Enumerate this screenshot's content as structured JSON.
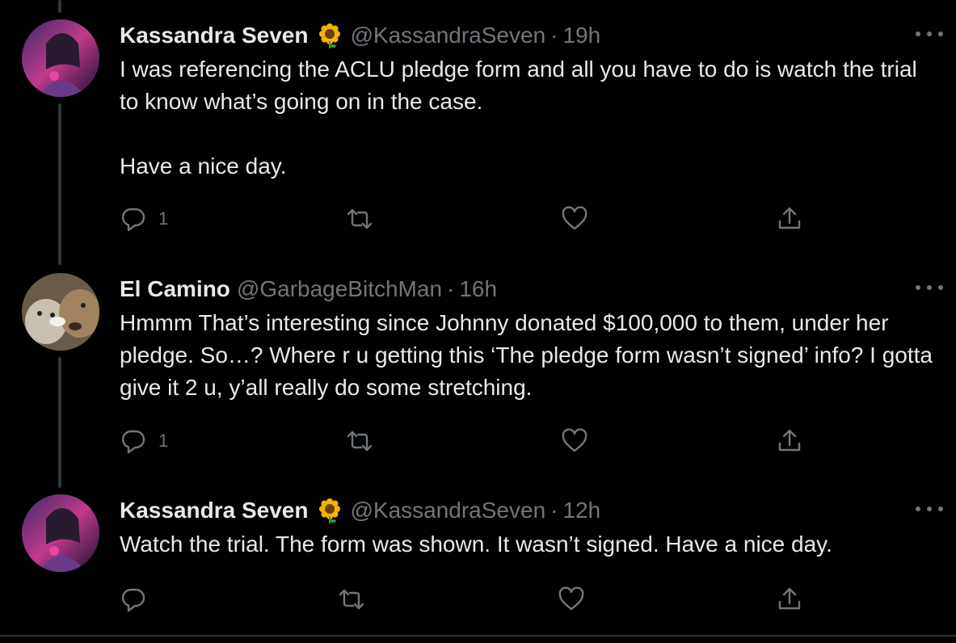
{
  "tweets": [
    {
      "name": "Kassandra Seven",
      "emoji": "sunflower-icon",
      "handle": "@KassandraSeven",
      "separator": "·",
      "time": "19h",
      "text": "I was referencing the ACLU pledge form and all you have to do is watch the trial to know what’s going on in the case.\n\nHave a nice day.",
      "replies": "1"
    },
    {
      "name": "El Camino",
      "handle": "@GarbageBitchMan",
      "separator": "·",
      "time": "16h",
      "text": "Hmmm That’s interesting since Johnny donated $100,000 to them, under her pledge. So…? Where r u getting this ‘The pledge form wasn’t signed’ info? I gotta give it 2 u, y’all really do some stretching.",
      "replies": "1"
    },
    {
      "name": "Kassandra Seven",
      "emoji": "sunflower-icon",
      "handle": "@KassandraSeven",
      "separator": "·",
      "time": "12h",
      "text": "Watch the trial. The form was shown. It wasn’t signed. Have a nice day.",
      "replies": ""
    }
  ],
  "colors": {
    "background": "#000000",
    "text": "#e7e9ea",
    "muted": "#71767b",
    "thread_line": "#333639"
  }
}
